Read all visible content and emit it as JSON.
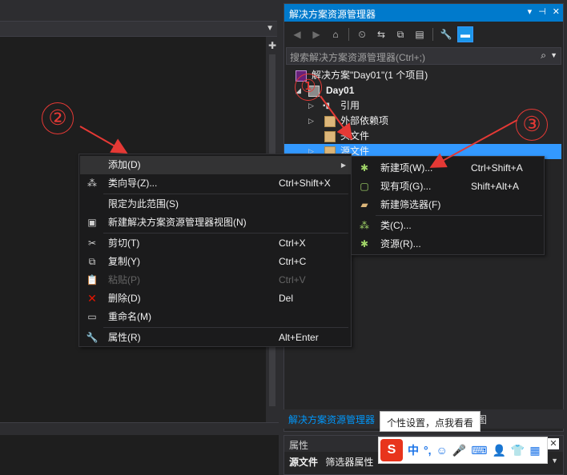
{
  "solution_explorer": {
    "title": "解决方案资源管理器",
    "search_placeholder": "搜索解决方案资源管理器(Ctrl+;)",
    "tree": {
      "solution": "解决方案\"Day01\"(1 个项目)",
      "project": "Day01",
      "references": "引用",
      "external_deps": "外部依赖项",
      "header_files": "头文件",
      "source_files": "源文件"
    },
    "tab_active": "解决方案资源管理器",
    "tab_other": "图"
  },
  "properties": {
    "title": "属性",
    "object_name": "源文件",
    "object_type": "筛选器属性"
  },
  "tooltip": "个性设置，点我看看",
  "ime": {
    "logo": "S",
    "items": [
      "中",
      "°,",
      "☺",
      "🎤",
      "⌨",
      "👤",
      "👕",
      "▦"
    ]
  },
  "context_menu": {
    "items": [
      {
        "label": "添加(D)",
        "shortcut": "",
        "icon": "none",
        "submenu": true
      },
      {
        "label": "类向导(Z)...",
        "shortcut": "Ctrl+Shift+X",
        "icon": "class-wizard-icon"
      },
      {
        "label": "限定为此范围(S)",
        "shortcut": "",
        "icon": "none"
      },
      {
        "label": "新建解决方案资源管理器视图(N)",
        "shortcut": "",
        "icon": "new-view-icon"
      },
      {
        "label": "剪切(T)",
        "shortcut": "Ctrl+X",
        "icon": "scissors-icon"
      },
      {
        "label": "复制(Y)",
        "shortcut": "Ctrl+C",
        "icon": "copy-icon"
      },
      {
        "label": "粘贴(P)",
        "shortcut": "Ctrl+V",
        "icon": "paste-icon",
        "disabled": true
      },
      {
        "label": "删除(D)",
        "shortcut": "Del",
        "icon": "delete-x-icon"
      },
      {
        "label": "重命名(M)",
        "shortcut": "",
        "icon": "rename-icon"
      },
      {
        "label": "属性(R)",
        "shortcut": "Alt+Enter",
        "icon": "wrench-icon"
      }
    ]
  },
  "submenu": {
    "items": [
      {
        "label": "新建项(W)...",
        "shortcut": "Ctrl+Shift+A",
        "icon": "new-item-icon"
      },
      {
        "label": "现有项(G)...",
        "shortcut": "Shift+Alt+A",
        "icon": "existing-item-icon"
      },
      {
        "label": "新建筛选器(F)",
        "shortcut": "",
        "icon": "new-filter-icon"
      },
      {
        "label": "类(C)...",
        "shortcut": "",
        "icon": "class-icon"
      },
      {
        "label": "资源(R)...",
        "shortcut": "",
        "icon": "resource-icon"
      }
    ]
  },
  "annotations": {
    "one": "①",
    "two": "②",
    "three": "③"
  },
  "colors": {
    "accent": "#007acc",
    "selection": "#3399ff",
    "annotation": "#e53935"
  }
}
